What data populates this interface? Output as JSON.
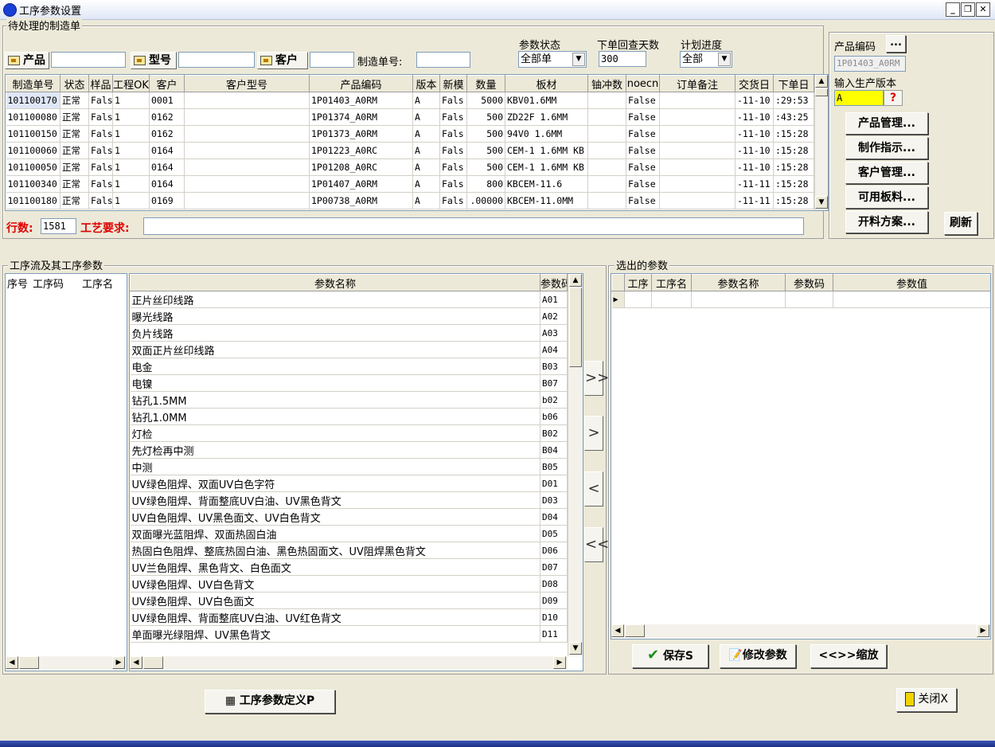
{
  "window": {
    "title": "工序参数设置",
    "min": "_",
    "restore": "❐",
    "close": "✕"
  },
  "orders": {
    "group_title": "待处理的制造单",
    "product_label": "产品",
    "model_label": "型号",
    "customer_label": "客户",
    "order_no_label": "制造单号:",
    "param_status_label": "参数状态",
    "param_status_value": "全部单",
    "lookback_days_label": "下单回查天数",
    "lookback_days_value": "300",
    "plan_progress_label": "计划进度",
    "plan_progress_value": "全部",
    "columns": [
      "制造单号",
      "状态",
      "样品",
      "工程OK",
      "客户",
      "客户型号",
      "产品编码",
      "版本",
      "新模",
      "数量",
      "板材",
      "铀冲数",
      "noecn",
      "订单备注",
      "交货日",
      "下单日"
    ],
    "rows": [
      [
        "101100170",
        "正常",
        "Fals",
        "1",
        "0001",
        "",
        "1P01403_A0RM",
        "A",
        "Fals",
        "5000",
        "KBV01.6MM",
        "",
        "False",
        "",
        "-11-10",
        ":29:53"
      ],
      [
        "101100080",
        "正常",
        "Fals",
        "1",
        "0162",
        "",
        "1P01374_A0RM",
        "A",
        "Fals",
        "500",
        "ZD22F 1.6MM",
        "",
        "False",
        "",
        "-11-10",
        ":43:25"
      ],
      [
        "101100150",
        "正常",
        "Fals",
        "1",
        "0162",
        "",
        "1P01373_A0RM",
        "A",
        "Fals",
        "500",
        "94V0 1.6MM",
        "",
        "False",
        "",
        "-11-10",
        ":15:28"
      ],
      [
        "101100060",
        "正常",
        "Fals",
        "1",
        "0164",
        "",
        "1P01223_A0RC",
        "A",
        "Fals",
        "500",
        "CEM-1 1.6MM KB",
        "",
        "False",
        "",
        "-11-10",
        ":15:28"
      ],
      [
        "101100050",
        "正常",
        "Fals",
        "1",
        "0164",
        "",
        "1P01208_A0RC",
        "A",
        "Fals",
        "500",
        "CEM-1 1.6MM KB",
        "",
        "False",
        "",
        "-11-10",
        ":15:28"
      ],
      [
        "101100340",
        "正常",
        "Fals",
        "1",
        "0164",
        "",
        "1P01407_A0RM",
        "A",
        "Fals",
        "800",
        "KBCEM-11.6",
        "",
        "False",
        "",
        "-11-11",
        ":15:28"
      ],
      [
        "101100180",
        "正常",
        "Fals",
        "1",
        "0169",
        "",
        "1P00738_A0RM",
        "A",
        "Fals",
        ".00000",
        "KBCEM-11.0MM",
        "",
        "False",
        "",
        "-11-11",
        ":15:28"
      ]
    ],
    "row_count_label": "行数:",
    "row_count_value": "1581",
    "process_req_label": "工艺要求:"
  },
  "side": {
    "product_code_label": "产品编码",
    "product_code_value": "1P01403_A0RM",
    "dots_label": "...",
    "input_version_label": "输入生产版本",
    "version_value": "A",
    "help_glyph": "?",
    "buttons": [
      "产品管理...",
      "制作指示...",
      "客户管理...",
      "可用板料...",
      "开料方案..."
    ],
    "refresh": "刷新"
  },
  "process": {
    "group_title": "工序流及其工序参数",
    "flow_columns": [
      "序号",
      "工序码",
      "工序名"
    ],
    "param_columns": [
      "参数名称",
      "参数码"
    ],
    "params": [
      [
        "正片丝印线路",
        "A01"
      ],
      [
        "曝光线路",
        "A02"
      ],
      [
        "负片线路",
        "A03"
      ],
      [
        "双面正片丝印线路",
        "A04"
      ],
      [
        "电金",
        "B03"
      ],
      [
        "电镍",
        "B07"
      ],
      [
        "钻孔1.5MM",
        "b02"
      ],
      [
        "钻孔1.0MM",
        "b06"
      ],
      [
        "灯检",
        "B02"
      ],
      [
        "先灯检再中测",
        "B04"
      ],
      [
        "中测",
        "B05"
      ],
      [
        "UV绿色阻焊、双面UV白色字符",
        "D01"
      ],
      [
        "UV绿色阻焊、背面整底UV白油、UV黑色背文",
        "D03"
      ],
      [
        "UV白色阻焊、UV黑色面文、UV白色背文",
        "D04"
      ],
      [
        "双面曝光蓝阻焊、双面热固白油",
        "D05"
      ],
      [
        "热固白色阻焊、整底热固白油、黑色热固面文、UV阻焊黑色背文",
        "D06"
      ],
      [
        "UV兰色阻焊、黑色背文、白色面文",
        "D07"
      ],
      [
        "UV绿色阻焊、UV白色背文",
        "D08"
      ],
      [
        "UV绿色阻焊、UV白色面文",
        "D09"
      ],
      [
        "UV绿色阻焊、背面整底UV白油、UV红色背文",
        "D10"
      ],
      [
        "单面曝光绿阻焊、UV黑色背文",
        "D11"
      ]
    ]
  },
  "transfer": {
    "add_all": ">>",
    "add": ">",
    "remove": "<",
    "remove_all": "<<"
  },
  "selected": {
    "group_title": "选出的参数",
    "columns": [
      "工序",
      "工序名",
      "参数名称",
      "参数码",
      "参数值"
    ],
    "save": "保存S",
    "modify": "修改参数",
    "zoom": "<<>>缩放"
  },
  "footer": {
    "define": "工序参数定义P",
    "close": "关闭X"
  }
}
